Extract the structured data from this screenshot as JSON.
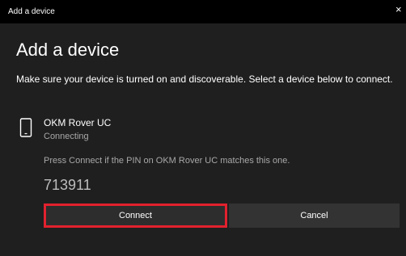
{
  "window": {
    "title": "Add a device",
    "close_glyph": "×"
  },
  "dialog": {
    "heading": "Add a device",
    "description": "Make sure your device is turned on and discoverable. Select a device below to connect."
  },
  "device": {
    "icon": "phone-icon",
    "name": "OKM Rover UC",
    "status": "Connecting",
    "pin_prompt": "Press Connect if the PIN on OKM Rover UC matches this one.",
    "pin": "713911"
  },
  "buttons": {
    "connect_label": "Connect",
    "cancel_label": "Cancel"
  },
  "colors": {
    "background": "#1f1f1f",
    "titlebar": "#000000",
    "highlight_border": "#e2212e",
    "secondary_text": "#a8a8a8"
  }
}
